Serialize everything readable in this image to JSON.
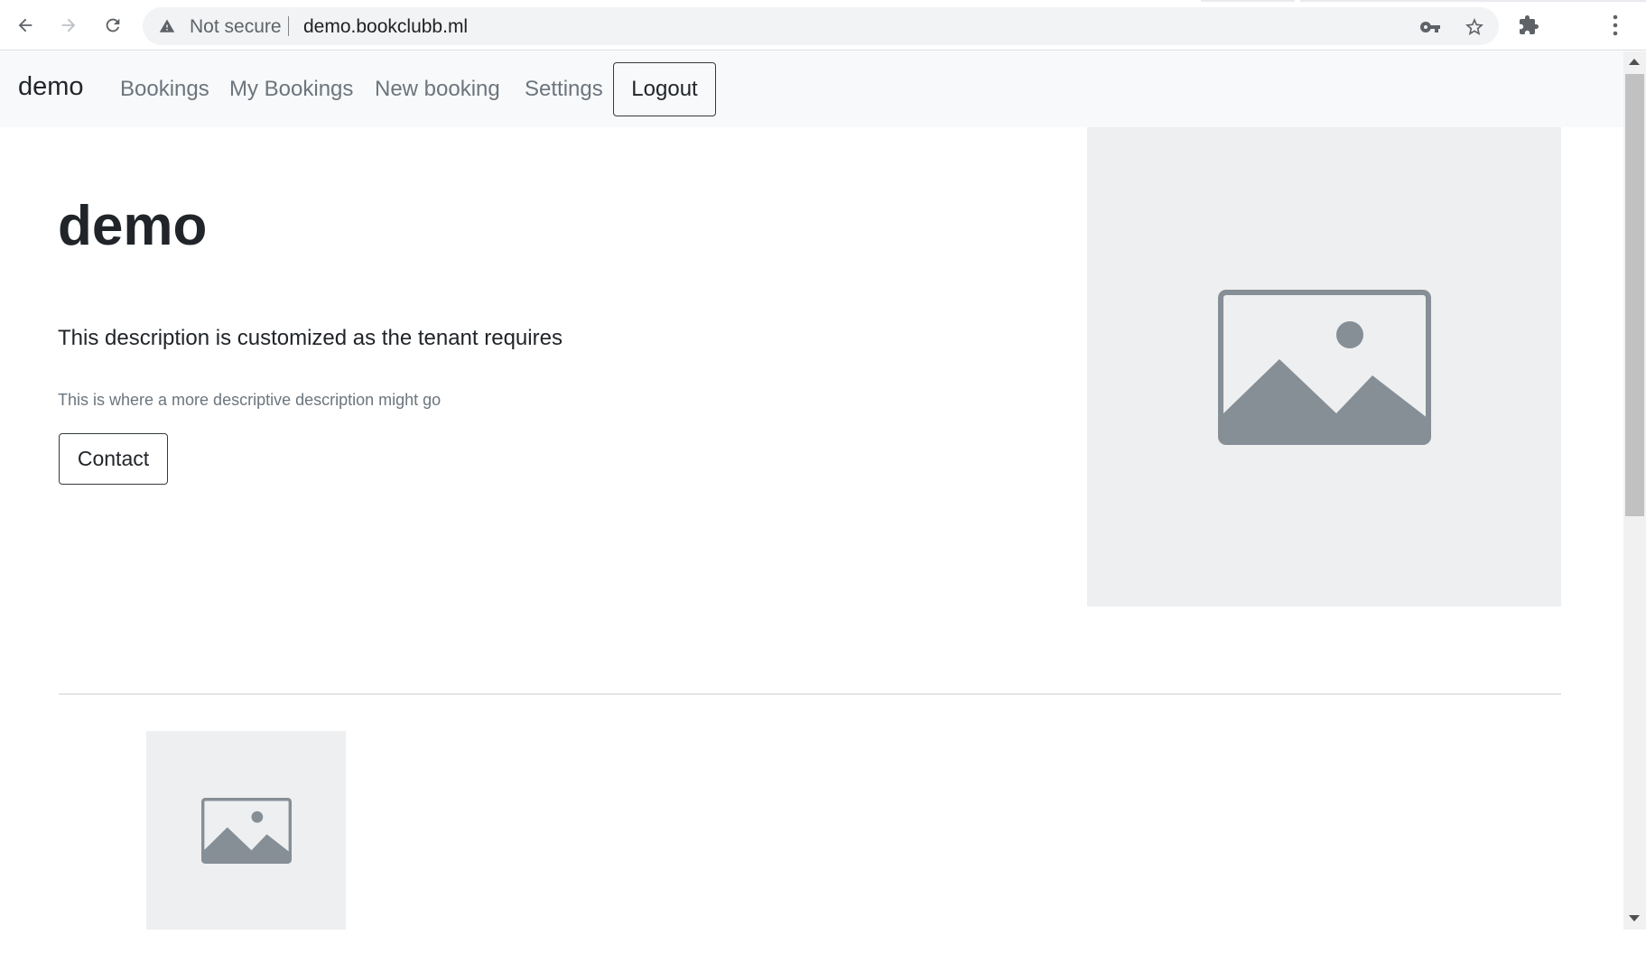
{
  "browser": {
    "security_label": "Not secure",
    "url": "demo.bookclubb.ml"
  },
  "navbar": {
    "brand": "demo",
    "links": [
      "Bookings",
      "My Bookings",
      "New booking",
      "Settings"
    ],
    "logout_label": "Logout"
  },
  "hero": {
    "title": "demo",
    "lead": "This description is customized as the tenant requires",
    "description": "This is where a more descriptive description might go",
    "contact_label": "Contact"
  },
  "colors": {
    "placeholder_bg": "#eeeff0",
    "placeholder_icon": "#868e96",
    "navbar_bg": "#f8f9fa"
  }
}
